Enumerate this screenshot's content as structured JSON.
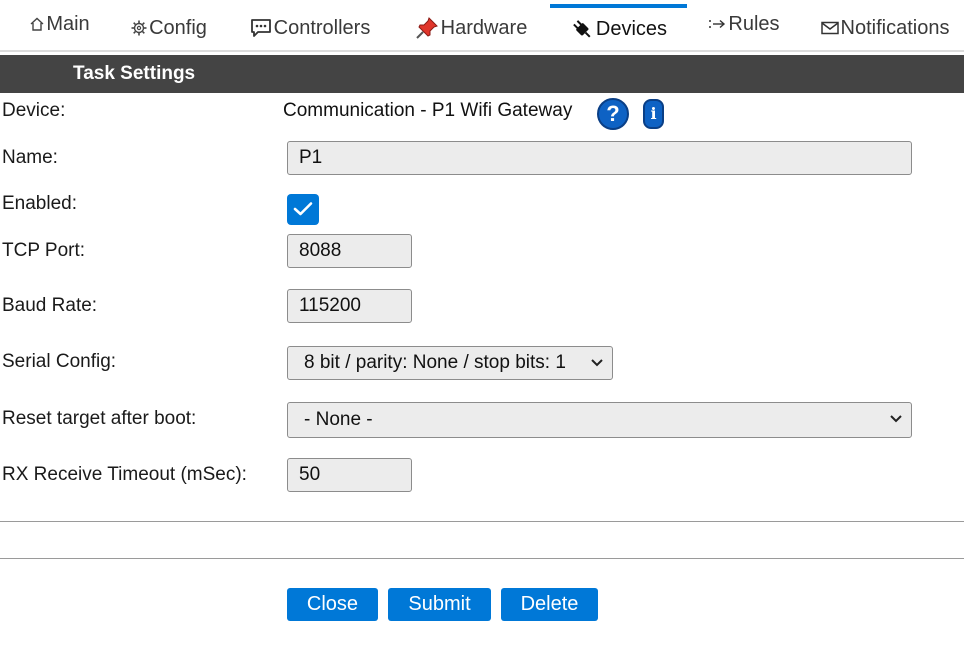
{
  "tabs": [
    {
      "id": "main",
      "label": "Main",
      "icon": "home-icon"
    },
    {
      "id": "config",
      "label": "Config",
      "icon": "gear-icon"
    },
    {
      "id": "controllers",
      "label": "Controllers",
      "icon": "speech-bubble-icon"
    },
    {
      "id": "hardware",
      "label": "Hardware",
      "icon": "pushpin-icon"
    },
    {
      "id": "devices",
      "label": "Devices",
      "icon": "plug-icon",
      "active": true
    },
    {
      "id": "rules",
      "label": "Rules",
      "icon": "arrow-right-icon"
    },
    {
      "id": "notifications",
      "label": "Notifications",
      "icon": "envelope-icon"
    }
  ],
  "section": {
    "title": "Task Settings"
  },
  "form": {
    "device": {
      "label": "Device:",
      "value": "Communication - P1 Wifi Gateway",
      "help_icon": "?",
      "info_icon": "i"
    },
    "name": {
      "label": "Name:",
      "value": "P1"
    },
    "enabled": {
      "label": "Enabled:",
      "checked": true
    },
    "tcp_port": {
      "label": "TCP Port:",
      "value": "8088"
    },
    "baud_rate": {
      "label": "Baud Rate:",
      "value": "115200"
    },
    "serial_config": {
      "label": "Serial Config:",
      "value": "8 bit / parity: None / stop bits: 1"
    },
    "reset_target": {
      "label": "Reset target after boot:",
      "value": "- None -"
    },
    "rx_timeout": {
      "label": "RX Receive Timeout (mSec):",
      "value": "50"
    }
  },
  "buttons": {
    "close": "Close",
    "submit": "Submit",
    "delete": "Delete"
  },
  "colors": {
    "accent": "#0078d7",
    "header_bg": "#444444",
    "icon_blue": "#0e62c4"
  }
}
